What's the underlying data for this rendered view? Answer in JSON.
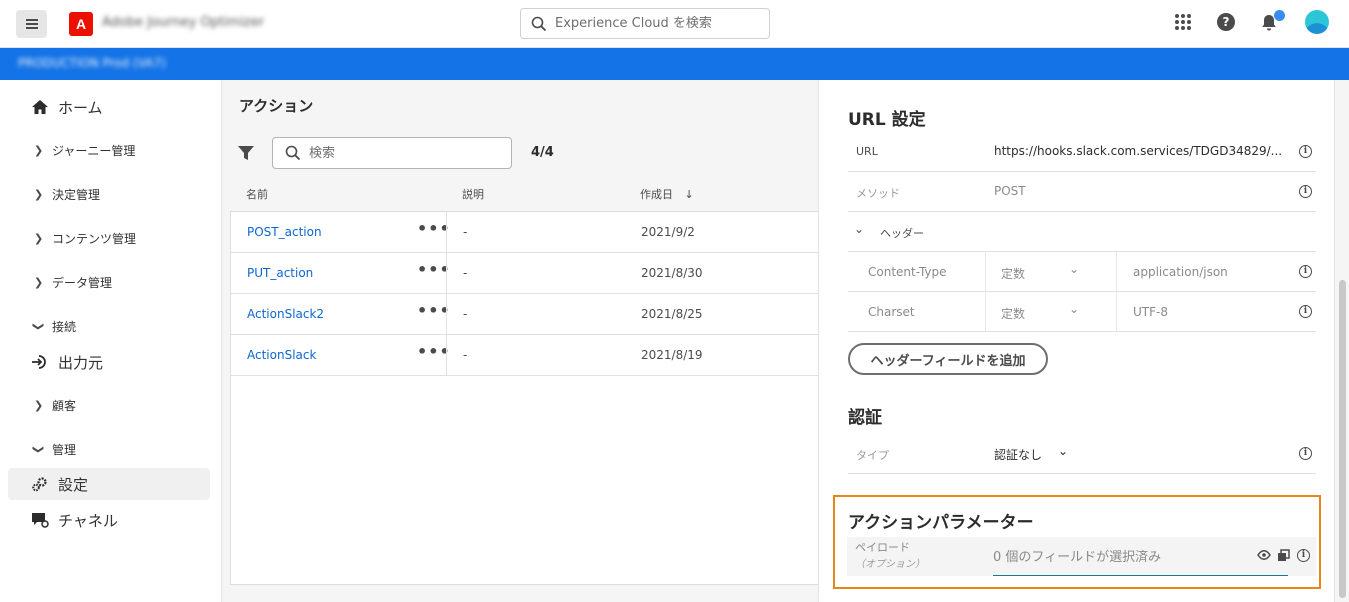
{
  "header": {
    "app_logo": "A",
    "app_name": "Adobe Journey Optimizer",
    "search_placeholder": "Experience Cloud を検索"
  },
  "context_bar": {
    "text": "PRODUCTION  Prod (VA7)"
  },
  "sidebar": {
    "items": [
      {
        "label": "ホーム",
        "type": "big",
        "icon": "home-icon"
      },
      {
        "label": "ジャーニー管理",
        "type": "collapsed"
      },
      {
        "label": "決定管理",
        "type": "collapsed"
      },
      {
        "label": "コンテンツ管理",
        "type": "collapsed"
      },
      {
        "label": "データ管理",
        "type": "collapsed"
      },
      {
        "label": "接続",
        "type": "expanded"
      },
      {
        "label": "出力元",
        "type": "big",
        "icon": "sources-icon"
      },
      {
        "label": "顧客",
        "type": "collapsed"
      },
      {
        "label": "管理",
        "type": "expanded"
      },
      {
        "label": "設定",
        "type": "big",
        "icon": "gears-icon",
        "active": true
      },
      {
        "label": "チャネル",
        "type": "big",
        "icon": "channel-icon"
      }
    ]
  },
  "main": {
    "title": "アクション",
    "search_placeholder": "検索",
    "count": "4/4",
    "columns": {
      "name": "名前",
      "description": "説明",
      "created": "作成日"
    },
    "rows": [
      {
        "name": "POST_action",
        "description": "-",
        "created": "2021/9/2"
      },
      {
        "name": "PUT_action",
        "description": "-",
        "created": "2021/8/30"
      },
      {
        "name": "ActionSlack2",
        "description": "-",
        "created": "2021/8/25"
      },
      {
        "name": "ActionSlack",
        "description": "-",
        "created": "2021/8/19"
      }
    ]
  },
  "panel": {
    "url_section": {
      "title": "URL 設定",
      "url_label": "URL",
      "url_value": "https://hooks.slack.com.services/TDGD34829/...",
      "method_label": "メソッド",
      "method_value": "POST",
      "headers_label": "ヘッダー",
      "headers": [
        {
          "name": "Content-Type",
          "type": "定数",
          "value": "application/json"
        },
        {
          "name": "Charset",
          "type": "定数",
          "value": "UTF-8"
        }
      ],
      "add_header_button": "ヘッダーフィールドを追加"
    },
    "auth_section": {
      "title": "認証",
      "type_label": "タイプ",
      "type_value": "認証なし"
    },
    "params_section": {
      "title": "アクションパラメーター",
      "payload_label": "ペイロード",
      "payload_sub": "（オプション）",
      "payload_placeholder": "0 個のフィールドが選択済み"
    }
  },
  "colors": {
    "brand_blue": "#1473e6",
    "link_blue": "#0d66d0",
    "highlight_orange": "#e68619",
    "adobe_red": "#eb1000"
  }
}
